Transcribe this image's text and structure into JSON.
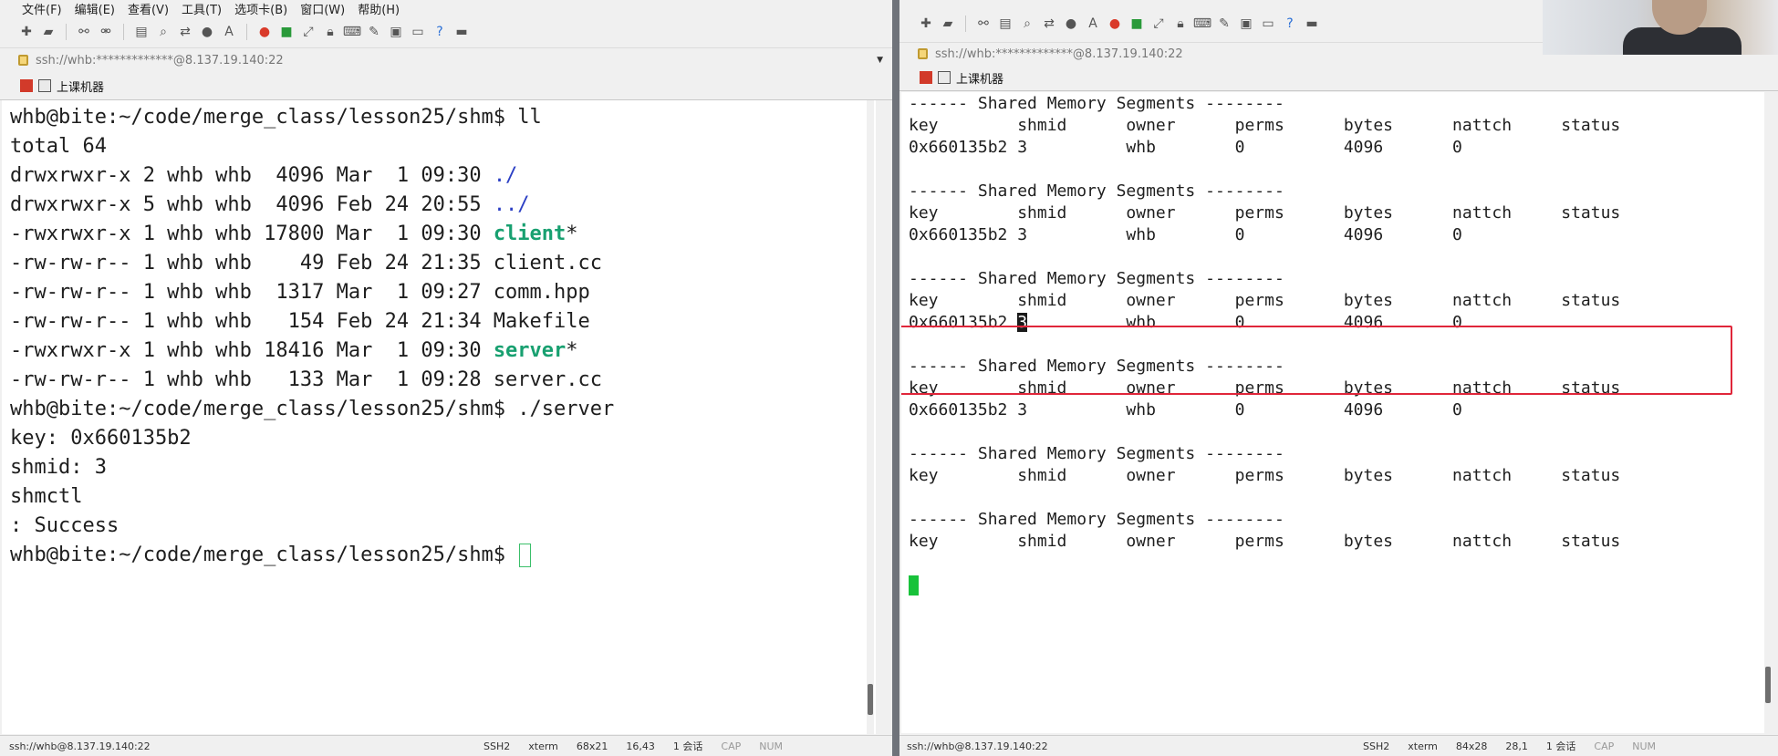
{
  "left_window": {
    "menu": [
      "文件(F)",
      "编辑(E)",
      "查看(V)",
      "工具(T)",
      "选项卡(B)",
      "窗口(W)",
      "帮助(H)"
    ],
    "address": "ssh://whb:*************@8.137.19.140:22",
    "session_tab": "上课机器",
    "terminal_lines": [
      "whb@bite:~/code/merge_class/lesson25/shm$ ll",
      "total 64",
      "drwxrwxr-x 2 whb whb  4096 Mar  1 09:30 ",
      "drwxrwxr-x 5 whb whb  4096 Feb 24 20:55 ",
      "-rwxrwxr-x 1 whb whb 17800 Mar  1 09:30 ",
      "-rw-rw-r-- 1 whb whb    49 Feb 24 21:35 client.cc",
      "-rw-rw-r-- 1 whb whb  1317 Mar  1 09:27 comm.hpp",
      "-rw-rw-r-- 1 whb whb   154 Feb 24 21:34 Makefile",
      "-rwxrwxr-x 1 whb whb 18416 Mar  1 09:30 ",
      "-rw-rw-r-- 1 whb whb   133 Mar  1 09:28 server.cc",
      "whb@bite:~/code/merge_class/lesson25/shm$ ./server",
      "key: 0x660135b2",
      "shmid: 3",
      "shmctl",
      ": Success",
      "whb@bite:~/code/merge_class/lesson25/shm$ "
    ],
    "colored_names": {
      "dot": "./",
      "dotdot": "../",
      "client": "client",
      "server": "server",
      "star": "*"
    },
    "status": {
      "connection": "ssh://whb@8.137.19.140:22",
      "protocol": "SSH2",
      "term": "xterm",
      "size": "68x21",
      "pos": "16,43",
      "sessions": "1 会话",
      "cap": "CAP",
      "num": "NUM"
    }
  },
  "right_window": {
    "address": "ssh://whb:*************@8.137.19.140:22",
    "session_tab": "上课机器",
    "header_line": "------ Shared Memory Segments --------",
    "columns": "key        shmid      owner      perms      bytes      nattch     status",
    "row_prefix": "0x660135b2 ",
    "row_shmid": "3",
    "row_rest": "          whb        0          4096       0",
    "row_full": "0x660135b2 3          whb        0          4096       0",
    "status": {
      "connection": "ssh://whb@8.137.19.140:22",
      "protocol": "SSH2",
      "term": "xterm",
      "size": "84x28",
      "pos": "28,1",
      "sessions": "1 会话",
      "cap": "CAP",
      "num": "NUM"
    }
  },
  "colors": {
    "highlight_box": "#e0263a",
    "exec_green": "#18a070",
    "dir_blue": "#2b3fc4",
    "cursor_green": "#18c23a"
  }
}
